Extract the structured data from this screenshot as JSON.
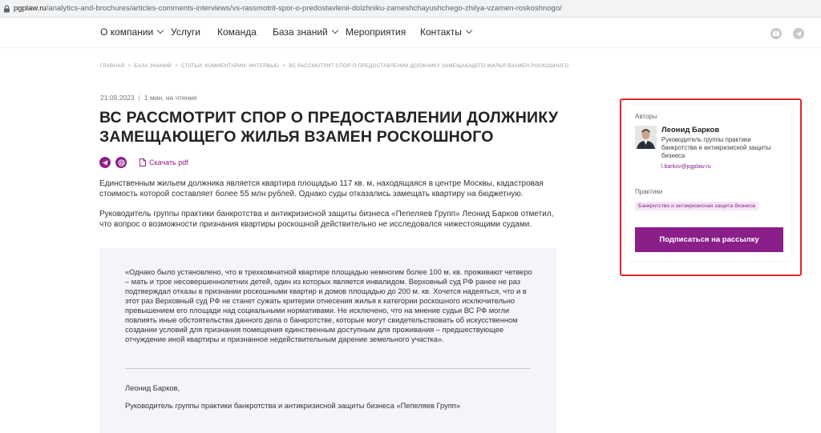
{
  "browser": {
    "url_host": "pgplaw.ru",
    "url_path": "/analytics-and-brochures/articles-comments-interviews/vs-rassmotrit-spor-o-predostavlenii-dolzhniku-zameshchayushchego-zhilya-vzamen-roskoshnogo/"
  },
  "nav": {
    "items": [
      {
        "label": "О компании",
        "has_dropdown": true
      },
      {
        "label": "Услуги",
        "has_dropdown": false
      },
      {
        "label": "Команда",
        "has_dropdown": false
      },
      {
        "label": "База знаний",
        "has_dropdown": true
      },
      {
        "label": "Мероприятия",
        "has_dropdown": false
      },
      {
        "label": "Контакты",
        "has_dropdown": true
      }
    ],
    "social_icons": [
      "youtube-icon",
      "telegram-icon"
    ]
  },
  "breadcrumb": {
    "items": [
      "ГЛАВНАЯ",
      "БАЗА ЗНАНИЙ",
      "СТАТЬИ, КОММЕНТАРИИ, ИНТЕРВЬЮ",
      "ВС РАССМОТРИТ СПОР О ПРЕДОСТАВЛЕНИИ ДОЛЖНИКУ ЗАМЕЩАЮЩЕГО ЖИЛЬЯ ВЗАМЕН РОСКОШНОГО"
    ],
    "separator": "•"
  },
  "article": {
    "date": "21.09.2023",
    "read_time": "1 мин. на чтение",
    "title": "ВС РАССМОТРИТ СПОР О ПРЕДОСТАВЛЕНИИ ДОЛЖНИКУ ЗАМЕЩАЮЩЕГО ЖИЛЬЯ ВЗАМЕН РОСКОШНОГО",
    "pdf_label": "Скачать pdf",
    "paragraph_1": "Единственным жильем должника является квартира площадью 117 кв. м, находящаяся в центре Москвы, кадастровая стоимость которой составляет более 55 млн рублей. Однако суды отказались замещать квартиру на бюджетную.",
    "paragraph_2": "Руководитель группы практики банкротства и антикризисной защиты бизнеса «Пепеляев Групп» Леонид Барков отметил, что вопрос о возможности признания квартиры роскошной действительно не исследовался нижестоящими судами."
  },
  "quote": {
    "text": "«Однако было установлено, что в трехкомнатной квартире площадью немногим более 100 м. кв. проживают четверо – мать и трое несовершеннолетних детей, один из которых является инвалидом. Верховный суд РФ ранее не раз подтверждал отказы в признании роскошными квартир и домов площадью до 200 м. кв. Хочется надеяться, что и в этот раз Верховный суд РФ не станет сужать критерии отнесения жилья к категории роскошного исключительно превышением его площади над социальными нормативами. Не исключено, что на мнение судьи ВС РФ могли повлиять иные обстоятельства данного дела о банкротстве, которые могут свидетельствовать об искусственном создании условий для признания помещения единственным доступным для проживания – предшествующее отчуждение иной квартиры и признанное недействительным дарение земельного участка».",
    "author": "Леонид Барков,",
    "role": "Руководитель группы практики банкротства и антикризисной защиты бизнеса «Пепеляев Групп»"
  },
  "sidebar": {
    "authors_label": "Авторы",
    "author_name": "Леонид Барков",
    "author_role": "Руководитель группы практики банкротства и антикризисной защиты бизнеса",
    "author_email": "l.barkov@pgplaw.ru",
    "practices_label": "Практики",
    "practice_tag": "Банкротство и антикризисная защита бизнеса",
    "subscribe_label": "Подписаться на рассылку"
  },
  "colors": {
    "accent": "#8a1f8a",
    "highlight_border": "#e3262a",
    "quote_bg": "#f4f5f8"
  }
}
